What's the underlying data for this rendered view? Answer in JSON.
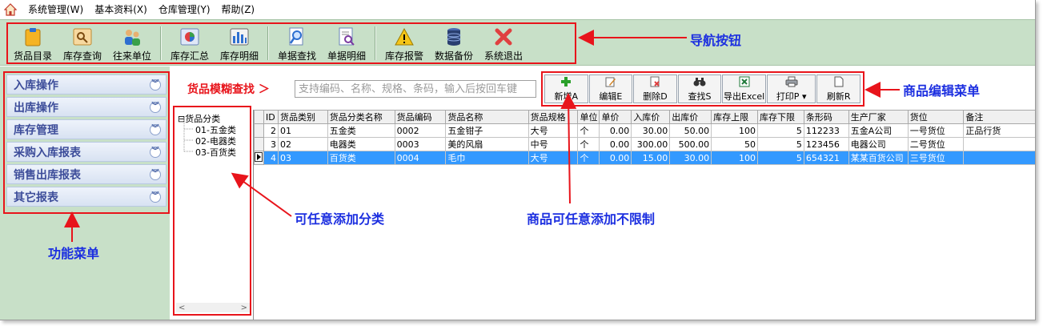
{
  "menubar": {
    "items": [
      "系统管理(W)",
      "基本资料(X)",
      "仓库管理(Y)",
      "帮助(Z)"
    ]
  },
  "toolbar": {
    "buttons": [
      "货品目录",
      "库存查询",
      "往来单位",
      "库存汇总",
      "库存明细",
      "单据查找",
      "单据明细",
      "库存报警",
      "数据备份",
      "系统退出"
    ]
  },
  "function_menu": {
    "items": [
      "入库操作",
      "出库操作",
      "库存管理",
      "采购入库报表",
      "销售出库报表",
      "其它报表"
    ]
  },
  "search": {
    "title": "货品模糊查找 ＞",
    "placeholder": "支持编码、名称、规格、条码，输入后按回车键"
  },
  "edit_menu": {
    "buttons": [
      "新增A",
      "编辑E",
      "删除D",
      "查找S",
      "导出Excel",
      "打印P",
      "刷新R"
    ]
  },
  "tree": {
    "root": "货品分类",
    "children": [
      "01-五金类",
      "02-电器类",
      "03-百货类"
    ]
  },
  "grid": {
    "columns": [
      "ID",
      "货品类别",
      "货品分类名称",
      "货品编码",
      "货品名称",
      "货品规格",
      "单位",
      "单价",
      "入库价",
      "出库价",
      "库存上限",
      "库存下限",
      "条形码",
      "生产厂家",
      "货位",
      "备注"
    ],
    "rows": [
      [
        "2",
        "01",
        "五金类",
        "0002",
        "五金钳子",
        "大号",
        "个",
        "0.00",
        "30.00",
        "50.00",
        "100",
        "5",
        "112233",
        "五金A公司",
        "一号货位",
        "正品行货"
      ],
      [
        "3",
        "02",
        "电器类",
        "0003",
        "美的风扇",
        "中号",
        "个",
        "0.00",
        "300.00",
        "500.00",
        "50",
        "5",
        "123456",
        "电器公司",
        "二号货位",
        ""
      ],
      [
        "4",
        "03",
        "百货类",
        "0004",
        "毛巾",
        "大号",
        "个",
        "0.00",
        "15.00",
        "30.00",
        "100",
        "5",
        "654321",
        "某某百货公司",
        "三号货位",
        ""
      ]
    ],
    "selected_row": 2
  },
  "annotations": {
    "nav": "导航按钮",
    "edit": "商品编辑菜单",
    "category": "可任意添加分类",
    "product": "商品可任意添加不限制",
    "function": "功能菜单"
  },
  "colors": {
    "highlight": "#e8141b",
    "callout": "#1c2fe0",
    "panel": "#c8e0c8",
    "selection": "#3399ff"
  }
}
